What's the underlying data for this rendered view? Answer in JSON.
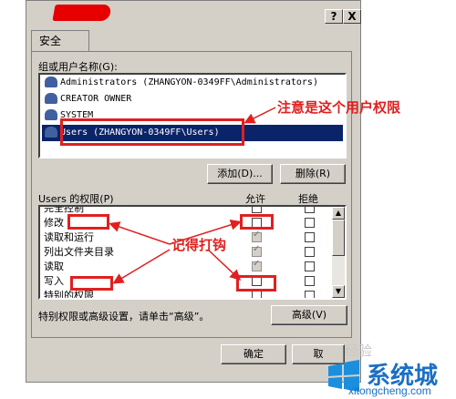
{
  "window": {
    "help_button": "?",
    "close_button": "X"
  },
  "tabs": [
    {
      "label": "安全"
    }
  ],
  "user_group": {
    "label": "组或用户名称(G):",
    "items": [
      {
        "name": "Administrators (ZHANGYON-0349FF\\Administrators)"
      },
      {
        "name": "CREATOR OWNER"
      },
      {
        "name": "SYSTEM"
      },
      {
        "name": "Users (ZHANGYON-0349FF\\Users)"
      }
    ],
    "add_button": "添加(D)...",
    "remove_button": "删除(R)"
  },
  "permissions": {
    "label": "Users 的权限(P)",
    "allow_header": "允许",
    "deny_header": "拒绝",
    "rows": [
      {
        "label": "完全控制"
      },
      {
        "label": "修改"
      },
      {
        "label": "读取和运行"
      },
      {
        "label": "列出文件夹目录"
      },
      {
        "label": "读取"
      },
      {
        "label": "写入"
      },
      {
        "label": "特别的权限"
      }
    ]
  },
  "advanced": {
    "text": "特别权限或高级设置，请单击“高级”。",
    "button": "高级(V)"
  },
  "footer": {
    "ok_button": "确定",
    "cancel_button": "取"
  },
  "annotations": {
    "user_note": "注意是这个用户权限",
    "check_note": "记得打钩"
  },
  "watermark": {
    "brand": "系统城",
    "url": "xitongcheng.com",
    "faint": "经验"
  },
  "colors": {
    "dialog": "#d4d0c8",
    "selection": "#0a246a",
    "annotation": "#e02020",
    "watermark": "#1a6fc4"
  }
}
